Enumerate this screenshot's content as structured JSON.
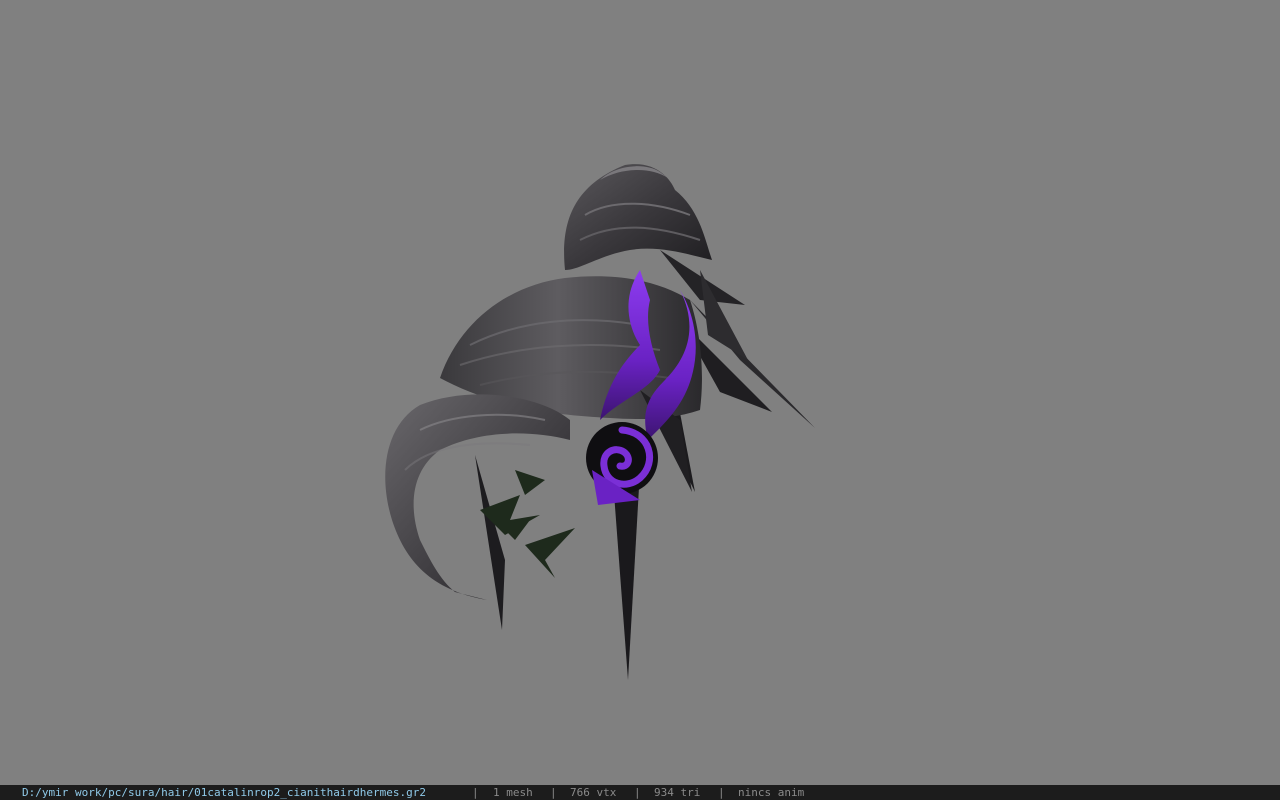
{
  "viewer": {
    "background_color": "#808080",
    "model_subject": "hair-model"
  },
  "statusbar": {
    "file_path": "D:/ymir work/pc/sura/hair/01catalinrop2_cianithairdhermes.gr2",
    "separator": "|",
    "mesh_count": "1 mesh",
    "vertex_count": "766 vtx",
    "triangle_count": "934 tri",
    "anim_status": "nincs anim",
    "path_color": "#8fc9e8",
    "text_color": "#8a8a8a"
  },
  "colors": {
    "hair_dark": "#2e2c30",
    "hair_mid": "#4a484c",
    "hair_light": "#6b696e",
    "accent_purple": "#7a2fd6",
    "accent_purple_dark": "#3c1470",
    "leaf_green": "#1e2a1c"
  }
}
